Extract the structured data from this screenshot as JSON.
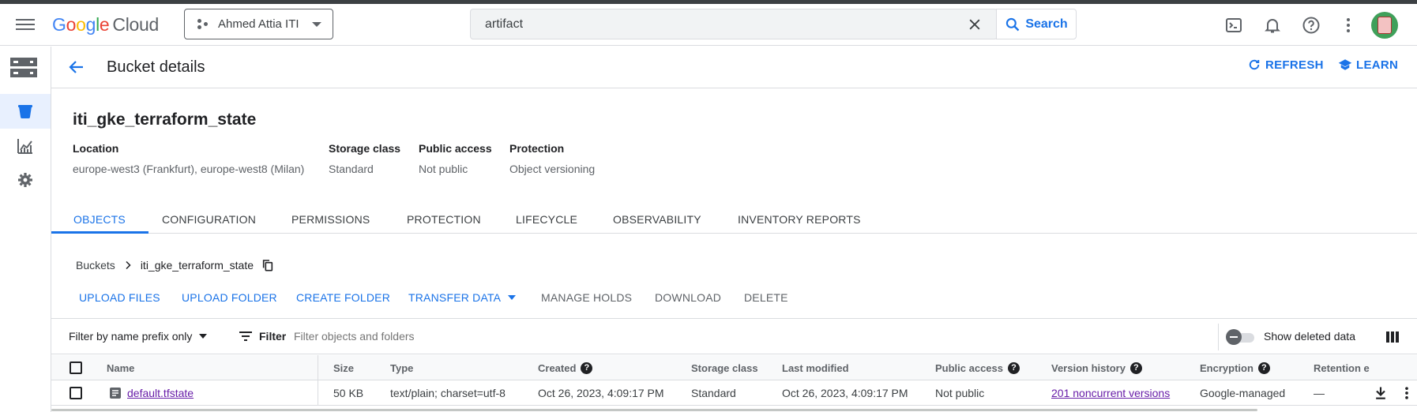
{
  "header": {
    "logo": {
      "g1": "G",
      "o1": "o",
      "o2": "o",
      "g2": "g",
      "l": "l",
      "e": "e",
      "cloud": "Cloud"
    },
    "project": "Ahmed Attia ITI",
    "search": {
      "value": "artifact",
      "button": "Search"
    }
  },
  "page": {
    "title": "Bucket details",
    "refresh": "REFRESH",
    "learn": "LEARN"
  },
  "bucket": {
    "name": "iti_gke_terraform_state",
    "meta": [
      {
        "label": "Location",
        "value": "europe-west3 (Frankfurt), europe-west8 (Milan)"
      },
      {
        "label": "Storage class",
        "value": "Standard"
      },
      {
        "label": "Public access",
        "value": "Not public"
      },
      {
        "label": "Protection",
        "value": "Object versioning"
      }
    ]
  },
  "tabs": [
    "OBJECTS",
    "CONFIGURATION",
    "PERMISSIONS",
    "PROTECTION",
    "LIFECYCLE",
    "OBSERVABILITY",
    "INVENTORY REPORTS"
  ],
  "breadcrumb": {
    "root": "Buckets",
    "current": "iti_gke_terraform_state"
  },
  "actions": {
    "upload_files": "UPLOAD FILES",
    "upload_folder": "UPLOAD FOLDER",
    "create_folder": "CREATE FOLDER",
    "transfer_data": "TRANSFER DATA",
    "manage_holds": "MANAGE HOLDS",
    "download": "DOWNLOAD",
    "delete": "DELETE"
  },
  "filterbar": {
    "mode": "Filter by name prefix only",
    "filter": "Filter",
    "placeholder": "Filter objects and folders",
    "show_deleted": "Show deleted data"
  },
  "table": {
    "columns": [
      "Name",
      "Size",
      "Type",
      "Created",
      "Storage class",
      "Last modified",
      "Public access",
      "Version history",
      "Encryption",
      "Retention e"
    ],
    "rows": [
      {
        "name": "default.tfstate",
        "size": "50 KB",
        "type": "text/plain; charset=utf-8",
        "created": "Oct 26, 2023, 4:09:17 PM",
        "storage_class": "Standard",
        "last_modified": "Oct 26, 2023, 4:09:17 PM",
        "public_access": "Not public",
        "version_history": "201 noncurrent versions",
        "encryption": "Google-managed",
        "retention": "—"
      }
    ]
  },
  "colors": {
    "accent": "#1a73e8",
    "visited_link": "#681da8",
    "border": "#dadce0"
  },
  "icons": [
    "menu-icon",
    "project-icon",
    "close-icon",
    "search-icon",
    "terminal-icon",
    "bell-icon",
    "help-icon",
    "more-vert-icon",
    "storage-icon",
    "bucket-icon",
    "monitoring-icon",
    "settings-icon",
    "back-arrow-icon",
    "refresh-icon",
    "school-icon",
    "copy-icon",
    "filter-icon",
    "columns-icon",
    "download-icon"
  ]
}
